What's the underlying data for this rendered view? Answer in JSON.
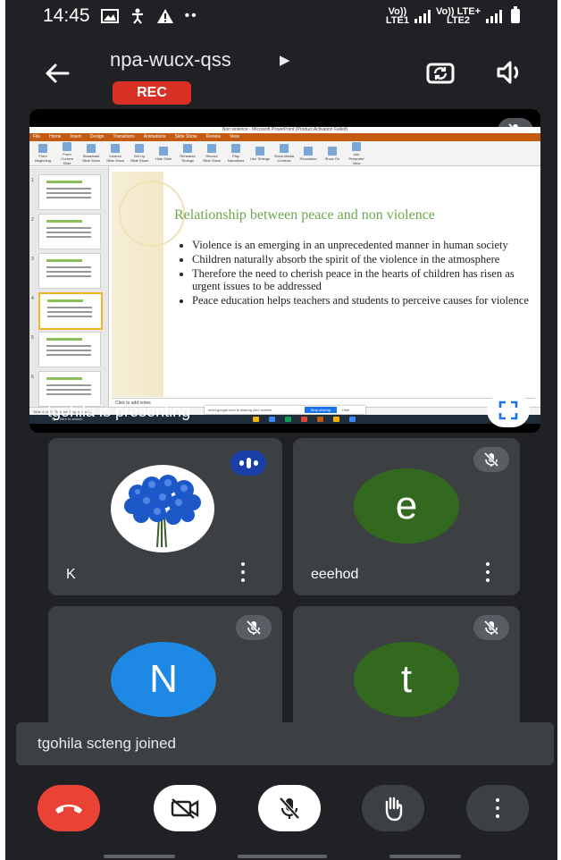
{
  "status_bar": {
    "time": "14:45",
    "left_icons": [
      "image-icon",
      "accessibility-icon",
      "warning-icon",
      "more-dots-icon"
    ],
    "sim1_label_top": "Vo))",
    "sim1_label_bottom": "LTE1",
    "sim2_label_top": "Vo)) LTE+",
    "sim2_label_bottom": "LTE2"
  },
  "header": {
    "meeting_code": "npa-wucx-qss",
    "rec_label": "REC"
  },
  "presentation": {
    "presenting_text": "tgohila is presenting",
    "window_title": "Non violence - Microsoft PowerPoint (Product Activation Failed)",
    "ribbon_tabs": [
      "File",
      "Home",
      "Insert",
      "Design",
      "Transitions",
      "Animations",
      "Slide Show",
      "Review",
      "View"
    ],
    "ribbon_items": [
      "From Beginning",
      "From Current Slide",
      "Broadcast Slide Show",
      "Custom Slide Show",
      "Set Up Slide Show",
      "Hide Slide",
      "Rehearse Timings",
      "Record Slide Show",
      "Play Narrations",
      "Use Timings",
      "Show Media Controls",
      "Resolution",
      "Show On",
      "Use Presenter View"
    ],
    "slide_heading": "Relationship between peace and non violence",
    "bullets": [
      "Violence is an emerging in an unprecedented manner in human society",
      "Children naturally absorb the spirit of the violence in the atmosphere",
      "Therefore the need to cherish peace in the hearts of children has risen as urgent issues to be addressed",
      "Peace education helps teachers and students to perceive causes for violence"
    ],
    "notes_placeholder": "Click to add notes",
    "status_text": "Slide 4 of 21   \"Solstice\"   English (India)",
    "share_notice": "meet.google.com is sharing your screen.",
    "stop_sharing": "Stop sharing",
    "hide_label": "Hide",
    "taskbar_search": "Type here to search"
  },
  "participants": [
    {
      "name": "K",
      "avatar": "blue-roses-photo",
      "state": "speaking"
    },
    {
      "name": "eeehod",
      "initial": "e",
      "avatar_color": "#33691e",
      "state": "muted"
    },
    {
      "name": "",
      "initial": "N",
      "avatar_color": "#1e88e5",
      "state": "muted"
    },
    {
      "name": "",
      "initial": "t",
      "avatar_color": "#33691e",
      "state": "muted"
    }
  ],
  "toast": {
    "message": "tgohila scteng joined"
  },
  "colors": {
    "background": "#202124",
    "tile": "#3c4043",
    "rec": "#d93025",
    "end_call": "#ea4335",
    "speaking": "#1a3fa6"
  },
  "controls": [
    "end-call-icon",
    "camera-off-icon",
    "mic-off-icon",
    "raise-hand-icon",
    "more-vert-icon"
  ]
}
